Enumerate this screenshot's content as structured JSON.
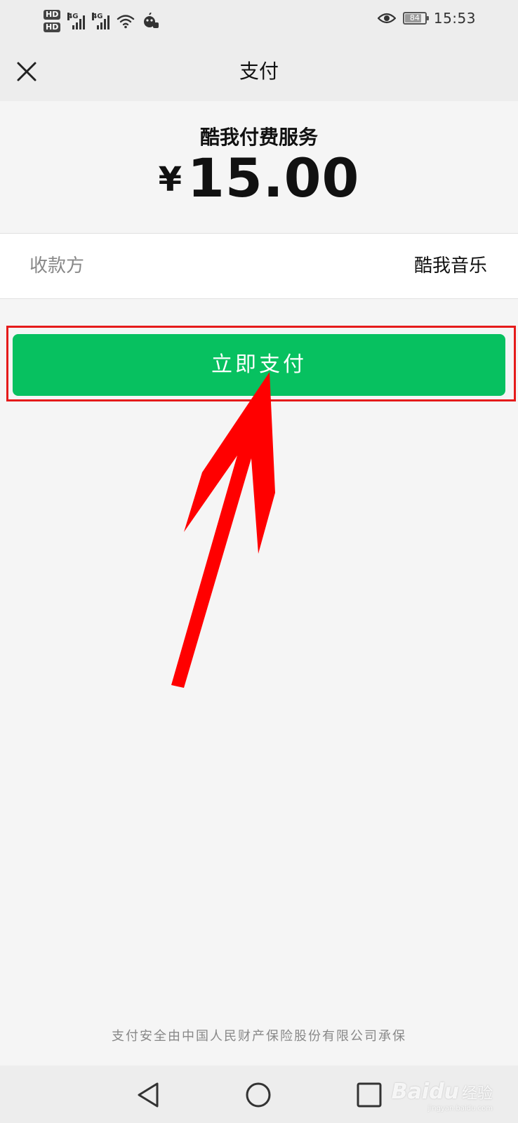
{
  "status_bar": {
    "hd1": "HD",
    "hd2": "HD",
    "signal1_label": "4G",
    "signal2_label": "4G",
    "battery": "84",
    "battery_level": 0.84,
    "time": "15:53",
    "icons": [
      "hd-icon",
      "signal-icon",
      "wifi-icon",
      "notification-icon",
      "eye-icon",
      "battery-icon"
    ]
  },
  "nav": {
    "title": "支付",
    "close_icon": "close-icon"
  },
  "order": {
    "product_name": "酷我付费服务",
    "currency_symbol": "¥",
    "amount": "15.00"
  },
  "payee": {
    "label": "收款方",
    "value": "酷我音乐"
  },
  "pay_button": {
    "label": "立即支付",
    "color": "#07c160"
  },
  "footer": {
    "note": "支付安全由中国人民财产保险股份有限公司承保"
  },
  "system_nav": {
    "icons": [
      "back-icon",
      "home-icon",
      "recents-icon"
    ]
  },
  "watermark": {
    "logo": "Baidu",
    "text": "经验",
    "url": "jingyan.baidu.com"
  },
  "annotation": {
    "highlight_color": "#e51b1b",
    "arrow_color": "#ff0000"
  }
}
